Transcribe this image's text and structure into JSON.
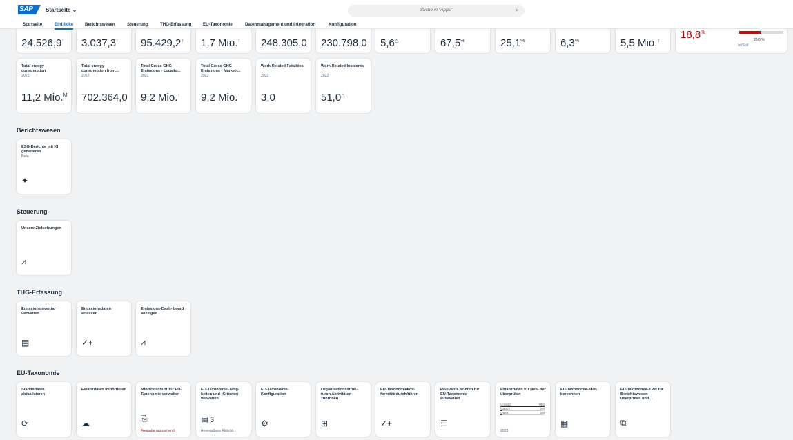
{
  "shell": {
    "title": "Startseite",
    "search_placeholder": "Suche in \"Apps\""
  },
  "tabs": [
    "Startseite",
    "Einblicke",
    "Berichtswesen",
    "Steuerung",
    "THG-Erfassung",
    "EU-Taxonomie",
    "Datenmanagement und Integration",
    "Konfiguration"
  ],
  "kpi_top": [
    "24.526,9",
    "3.037,3",
    "95.429,2",
    "1,7 Mio.",
    "248.305,0",
    "230.798,0",
    "5,6",
    "67,5",
    "25,1",
    "6,3",
    "5,5 Mio.",
    "18,8"
  ],
  "progress": {
    "label": "20,0 %",
    "legend": "Ist/Soll",
    "fill_percent": 50,
    "target_percent": 48
  },
  "kpi_row2": [
    {
      "title": "Total energy consumption",
      "year": "2023",
      "value": "11,2 Mio."
    },
    {
      "title": "Total energy consumption from...",
      "year": "2022",
      "value": "702.364,0"
    },
    {
      "title": "Total Gross GHG Emissions - Locatio...",
      "year": "2022",
      "value": "9,2 Mio."
    },
    {
      "title": "Total Gross GHG Emissions - Market-...",
      "year": "2022",
      "value": "9,2 Mio."
    },
    {
      "title": "Work-Related Fatalities",
      "year": "2022",
      "value": "3,0"
    },
    {
      "title": "Work-Related Incidents",
      "year": "2022",
      "value": "51,0"
    }
  ],
  "sections": {
    "berichtswesen": {
      "title": "Berichtswesen",
      "tiles": [
        {
          "title": "ESG-Berichte mit KI generieren",
          "sub": "Beta"
        }
      ]
    },
    "steuerung": {
      "title": "Steuerung",
      "tiles": [
        {
          "title": "Unsere Zielsetzungen"
        }
      ]
    },
    "thg": {
      "title": "THG-Erfassung",
      "tiles": [
        {
          "title": "Emissionsinventar verwalten"
        },
        {
          "title": "Emissionsdaten erfassen"
        },
        {
          "title": "Emissions-Dash- board anzeigen"
        }
      ]
    },
    "eu": {
      "title": "EU-Taxonomie",
      "tiles": [
        {
          "title": "Stammdaten aktualisieren"
        },
        {
          "title": "Finanzdaten importieren"
        },
        {
          "title": "Mindestschutz für EU-Taxonomie verwalten",
          "foot": "Freigabe ausstehend"
        },
        {
          "title": "EU-Taxonomie-Tätig- keiten und -Kriterien verwalten",
          "num": "3",
          "foot": "Anwendbare Aktivitä..."
        },
        {
          "title": "EU-Taxonomie- Konfiguration"
        },
        {
          "title": "Organisationsstruk- turen Aktivitäten zuordnen"
        },
        {
          "title": "EU-Taxonomiekon- formität durchführen"
        },
        {
          "title": "Relevante Konten für EU-Taxonomie auswählen"
        },
        {
          "title": "Finanzdaten für Nen- ner überprüfen",
          "foot": "2023"
        },
        {
          "title": "EU-Taxonomie-KPIs berechnen"
        },
        {
          "title": "EU-Taxonomie-KPIs für Berichtswesen überprüfen und..."
        }
      ]
    }
  },
  "mini_table": [
    {
      "label": "Umsatz",
      "value": "78M",
      "frac": 1.0
    },
    {
      "label": "CapEx",
      "value": "2M",
      "frac": 0.05
    },
    {
      "label": "OpEx",
      "value": "1M",
      "frac": 0.03
    }
  ],
  "icons": {
    "logo": "sap-logo",
    "search": "search-icon"
  }
}
